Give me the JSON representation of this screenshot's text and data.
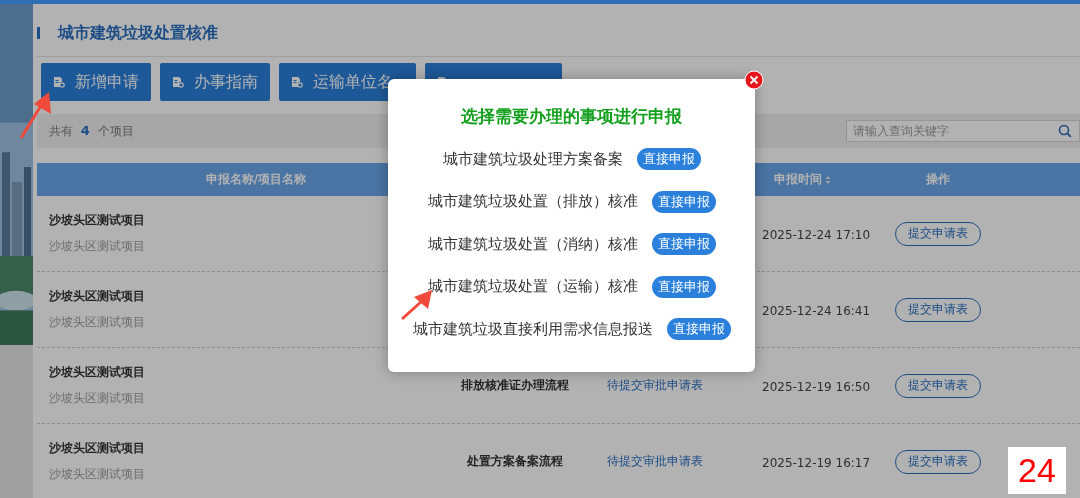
{
  "page_title": "城市建筑垃圾处置核准",
  "toolbar_buttons": [
    {
      "kind": "labeled",
      "label": "新增申请"
    },
    {
      "kind": "labeled",
      "label": "办事指南"
    },
    {
      "kind": "labeled",
      "label": "运输单位名"
    },
    {
      "kind": "covered"
    }
  ],
  "summary": {
    "prefix": "共有",
    "count": "4",
    "suffix": "个项目"
  },
  "search": {
    "placeholder": "请输入查询关键字"
  },
  "table": {
    "columns": [
      {
        "label": "申报名称/项目名称",
        "sortable": false
      },
      {
        "label": "申报时间",
        "sortable": true
      },
      {
        "label": "操作",
        "sortable": false
      }
    ],
    "rows": [
      {
        "name": "沙坡头区测试项目",
        "project": "沙坡头区测试项目",
        "time": "2025-12-24 17:10",
        "action": "提交申请表"
      },
      {
        "name": "沙坡头区测试项目",
        "project": "沙坡头区测试项目",
        "time": "2025-12-24 16:41",
        "action": "提交申请表"
      },
      {
        "name": "沙坡头区测试项目",
        "project": "沙坡头区测试项目",
        "flow": "排放核准证办理流程",
        "status": "待提交审批申请表",
        "time": "2025-12-19 16:50",
        "action": "提交申请表"
      },
      {
        "name": "沙坡头区测试项目",
        "project": "沙坡头区测试项目",
        "flow": "处置方案备案流程",
        "status": "待提交审批申请表",
        "time": "2025-12-19 16:17",
        "action": "提交申请表"
      }
    ]
  },
  "dialog": {
    "title": "选择需要办理的事项进行申报",
    "items": [
      {
        "label": "城市建筑垃圾处理方案备案",
        "button": "直接申报"
      },
      {
        "label": "城市建筑垃圾处置（排放）核准",
        "button": "直接申报"
      },
      {
        "label": "城市建筑垃圾处置（消纳）核准",
        "button": "直接申报"
      },
      {
        "label": "城市建筑垃圾处置（运输）核准",
        "button": "直接申报"
      },
      {
        "label": "城市建筑垃圾直接利用需求信息报送",
        "button": "直接申报"
      }
    ]
  },
  "step_badge": "24"
}
